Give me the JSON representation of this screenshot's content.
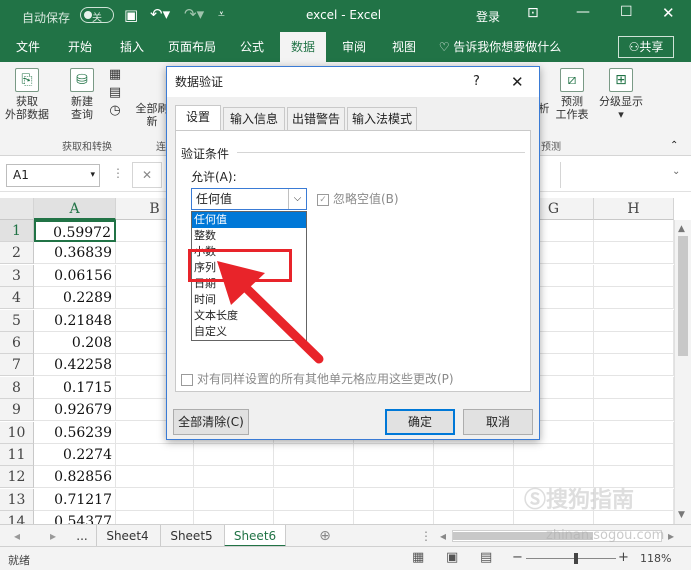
{
  "titlebar": {
    "autosave_label": "自动保存",
    "autosave_state": "关",
    "title": "excel  -  Excel",
    "login": "登录"
  },
  "tabs": [
    "文件",
    "开始",
    "插入",
    "页面布局",
    "公式",
    "数据",
    "审阅",
    "视图"
  ],
  "tell_me": "告诉我你想要做什么",
  "share": "共享",
  "ribbon": {
    "get_data": "获取\n外部数据",
    "new_query": "新建\n查询",
    "group_get_transform": "获取和转换",
    "refresh_all": "全部刷新",
    "group_connections": "连",
    "analysis_partial": "析",
    "forecast": "预测\n工作表",
    "group_forecast_partial": "预测",
    "outline": "分级显示"
  },
  "formula_bar": {
    "name_box": "A1"
  },
  "grid": {
    "columns": [
      "A",
      "B",
      "G",
      "H"
    ],
    "rows": [
      "1",
      "2",
      "3",
      "4",
      "5",
      "6",
      "7",
      "8",
      "9",
      "10",
      "11",
      "12",
      "13",
      "14",
      "15"
    ],
    "col_a_values": [
      "0.59972",
      "0.36839",
      "0.06156",
      "0.2289",
      "0.21848",
      "0.208",
      "0.42258",
      "0.1715",
      "0.92679",
      "0.56239",
      "0.2274",
      "0.82856",
      "0.71217",
      "0.54377",
      ""
    ]
  },
  "sheets": {
    "nav_more": "...",
    "names": [
      "Sheet4",
      "Sheet5",
      "Sheet6"
    ],
    "active": "Sheet6"
  },
  "status": {
    "ready": "就绪",
    "zoom": "118%"
  },
  "dialog": {
    "title": "数据验证",
    "tabs": [
      "设置",
      "输入信息",
      "出错警告",
      "输入法模式"
    ],
    "section": "验证条件",
    "allow_label": "允许(A):",
    "allow_value": "任何值",
    "ignore_blank": "忽略空值(B)",
    "options": [
      "任何值",
      "整数",
      "小数",
      "序列",
      "日期",
      "时间",
      "文本长度",
      "自定义"
    ],
    "apply_all": "对有同样设置的所有其他单元格应用这些更改(P)",
    "clear_all": "全部清除(C)",
    "ok": "确定",
    "cancel": "取消"
  },
  "watermark": {
    "brand": "搜狗指南",
    "url": "zhinan.sogou.com"
  },
  "colors": {
    "excel_green": "#217346",
    "highlight_red": "#e8242a",
    "selection_blue": "#0078d7"
  }
}
